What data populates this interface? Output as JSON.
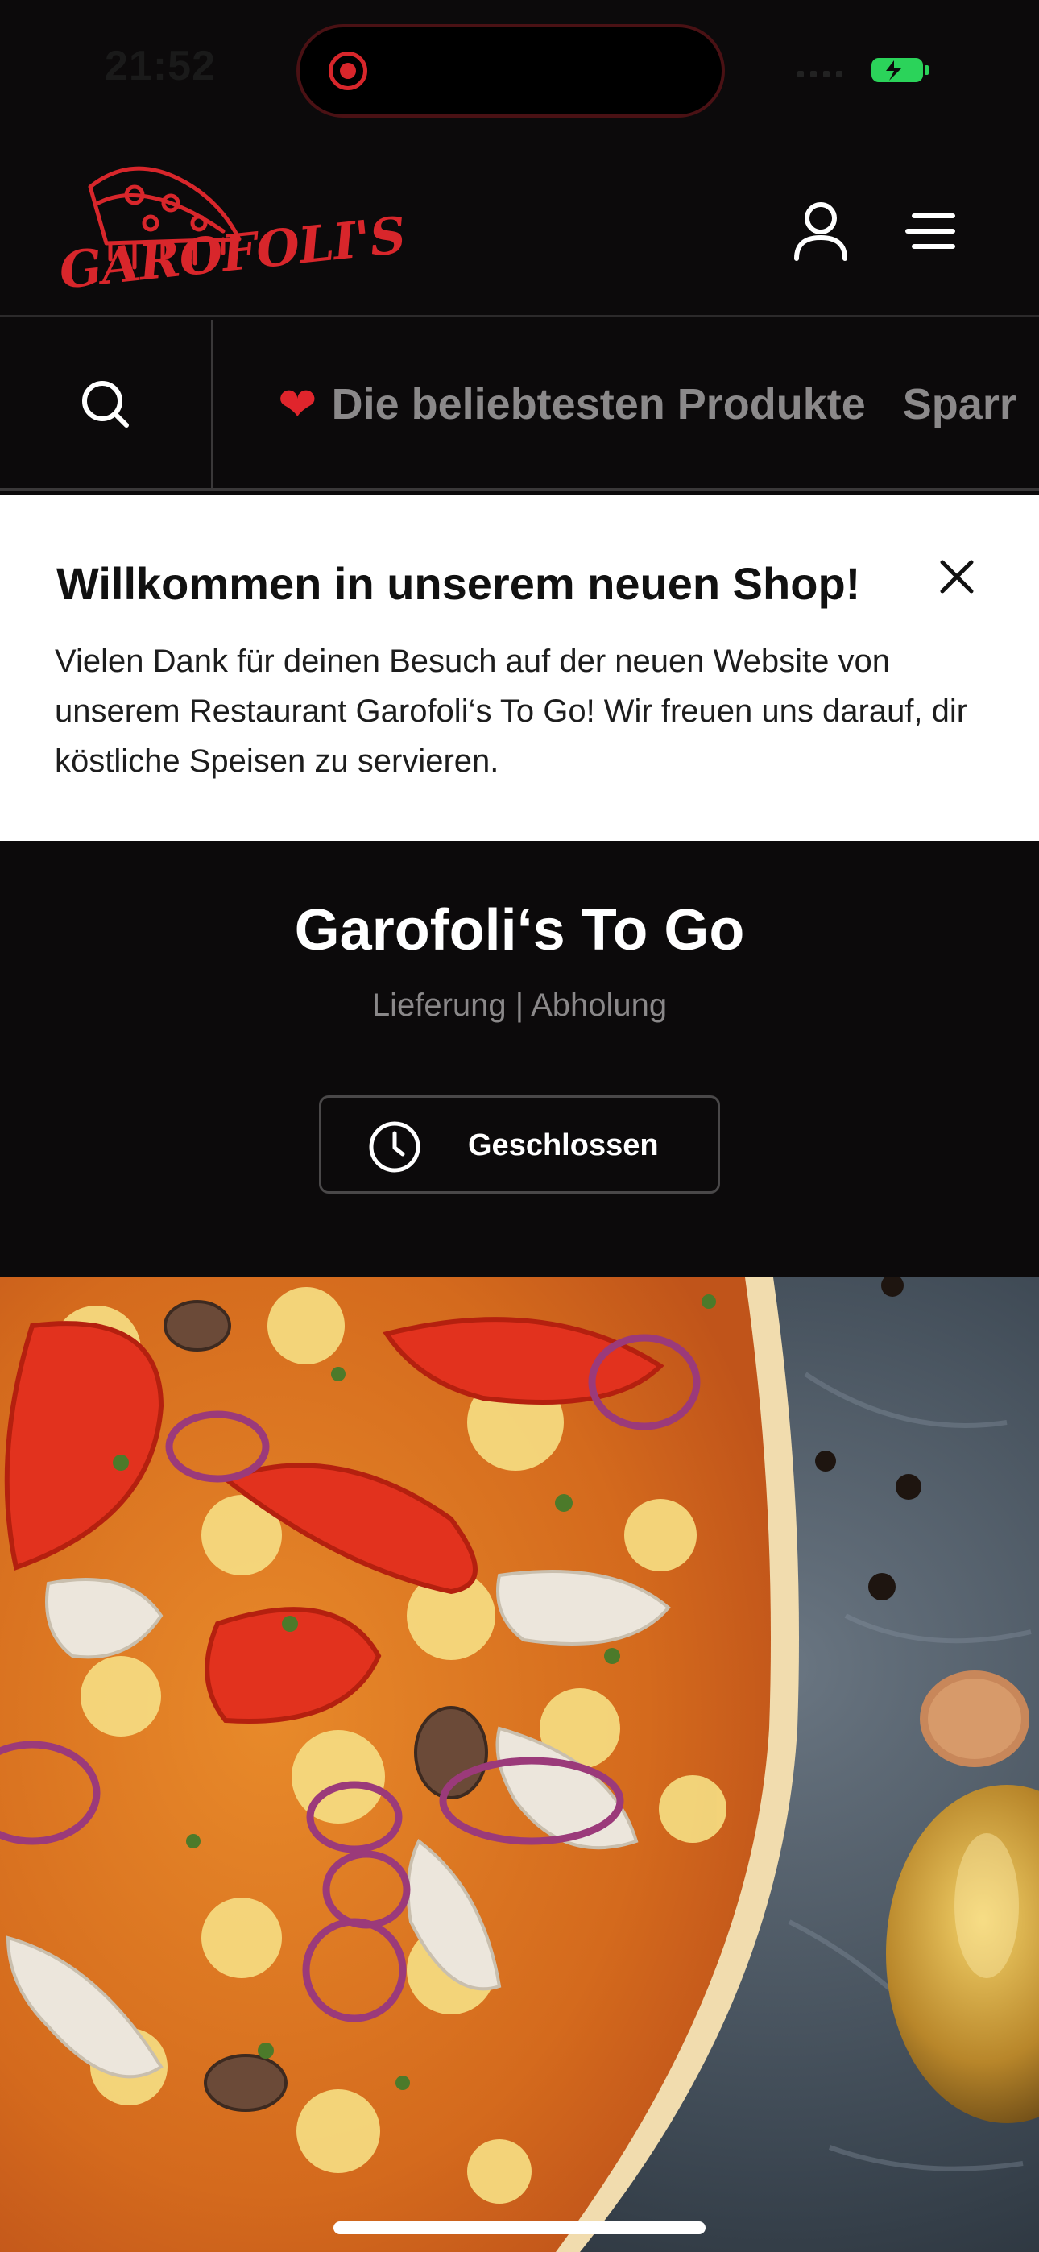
{
  "status_bar": {
    "time": "21:52"
  },
  "header": {
    "logo_text": "GAROFOLI'S",
    "brand_color": "#d8262b"
  },
  "categories": {
    "items": [
      {
        "icon": "heart-icon",
        "label": "Die beliebtesten Produkte"
      },
      {
        "label": "Sparr"
      }
    ]
  },
  "welcome_banner": {
    "title": "Willkommen in unserem neuen Shop!",
    "text": "Vielen Dank für deinen Besuch auf der neuen Website von unserem Restaurant Garofoli‘s To Go! Wir freuen uns darauf, dir köstliche Speisen zu servieren."
  },
  "shop": {
    "name": "Garofoli‘s To Go",
    "modes": "Lieferung | Abholung",
    "status_label": "Geschlossen"
  }
}
